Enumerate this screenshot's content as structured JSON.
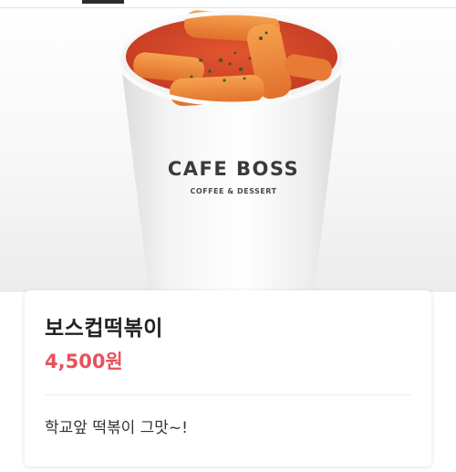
{
  "product": {
    "brand_text": "CAFE BOSS",
    "brand_subtext": "COFFEE & DESSERT",
    "name": "보스컵떡볶이",
    "price": "4,500원",
    "description": "학교앞 떡볶이 그맛~!"
  },
  "colors": {
    "price": "#e8515b",
    "sauce": "#d8452a",
    "rice_cake": "#f08a3c"
  },
  "icons": {
    "cup_image": "product-cup-image"
  }
}
